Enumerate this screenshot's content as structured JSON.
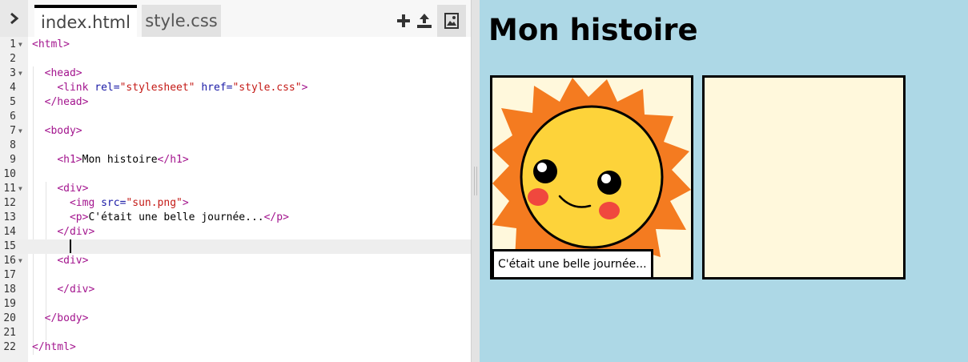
{
  "editor": {
    "tabs": [
      {
        "label": "index.html",
        "active": true
      },
      {
        "label": "style.css",
        "active": false
      }
    ],
    "toolbar_icons": [
      "plus-icon",
      "upload-icon",
      "image-icon"
    ],
    "active_line": 15,
    "lines": [
      {
        "n": "1",
        "fold": true,
        "code": [
          [
            "t",
            "<html>"
          ]
        ]
      },
      {
        "n": "2",
        "fold": false,
        "code": []
      },
      {
        "n": "3",
        "fold": true,
        "code": [
          [
            "",
            "  "
          ],
          [
            "t",
            "<head>"
          ]
        ]
      },
      {
        "n": "4",
        "fold": false,
        "code": [
          [
            "",
            "    "
          ],
          [
            "t",
            "<link "
          ],
          [
            "a",
            "rel="
          ],
          [
            "s",
            "\"stylesheet\""
          ],
          [
            "a",
            " href="
          ],
          [
            "s",
            "\"style.css\""
          ],
          [
            "t",
            ">"
          ]
        ]
      },
      {
        "n": "5",
        "fold": false,
        "code": [
          [
            "",
            "  "
          ],
          [
            "t",
            "</head>"
          ]
        ]
      },
      {
        "n": "6",
        "fold": false,
        "code": []
      },
      {
        "n": "7",
        "fold": true,
        "code": [
          [
            "",
            "  "
          ],
          [
            "t",
            "<body>"
          ]
        ]
      },
      {
        "n": "8",
        "fold": false,
        "code": []
      },
      {
        "n": "9",
        "fold": false,
        "code": [
          [
            "",
            "    "
          ],
          [
            "t",
            "<h1>"
          ],
          [
            "",
            "Mon histoire"
          ],
          [
            "t",
            "</h1>"
          ]
        ]
      },
      {
        "n": "10",
        "fold": false,
        "code": []
      },
      {
        "n": "11",
        "fold": true,
        "code": [
          [
            "",
            "    "
          ],
          [
            "t",
            "<div>"
          ]
        ]
      },
      {
        "n": "12",
        "fold": false,
        "code": [
          [
            "",
            "      "
          ],
          [
            "t",
            "<img "
          ],
          [
            "a",
            "src="
          ],
          [
            "s",
            "\"sun.png\""
          ],
          [
            "t",
            ">"
          ]
        ]
      },
      {
        "n": "13",
        "fold": false,
        "code": [
          [
            "",
            "      "
          ],
          [
            "t",
            "<p>"
          ],
          [
            "",
            "C'était une belle journée..."
          ],
          [
            "t",
            "</p>"
          ]
        ]
      },
      {
        "n": "14",
        "fold": false,
        "code": [
          [
            "",
            "    "
          ],
          [
            "t",
            "</div>"
          ]
        ]
      },
      {
        "n": "15",
        "fold": false,
        "code": [
          [
            "",
            "      "
          ]
        ],
        "cursor": true
      },
      {
        "n": "16",
        "fold": true,
        "code": [
          [
            "",
            "    "
          ],
          [
            "t",
            "<div>"
          ]
        ]
      },
      {
        "n": "17",
        "fold": false,
        "code": []
      },
      {
        "n": "18",
        "fold": false,
        "code": [
          [
            "",
            "    "
          ],
          [
            "t",
            "</div>"
          ]
        ]
      },
      {
        "n": "19",
        "fold": false,
        "code": []
      },
      {
        "n": "20",
        "fold": false,
        "code": [
          [
            "",
            "  "
          ],
          [
            "t",
            "</body>"
          ]
        ]
      },
      {
        "n": "21",
        "fold": false,
        "code": []
      },
      {
        "n": "22",
        "fold": false,
        "code": [
          [
            "t",
            "</html>"
          ]
        ]
      }
    ]
  },
  "preview": {
    "title": "Mon histoire",
    "caption": "C'était une belle journée...",
    "background": "#add8e6",
    "panel_background": "#fff8dc",
    "sun_colors": {
      "rays": "#f47b20",
      "face": "#fdd33a",
      "cheeks": "#f0483e"
    }
  },
  "colors": {
    "tag": "#a3158e",
    "attribute": "#1a1aa6",
    "string": "#c41a16",
    "gutter": "#f0f0f0",
    "active_line": "#eeeeee"
  }
}
